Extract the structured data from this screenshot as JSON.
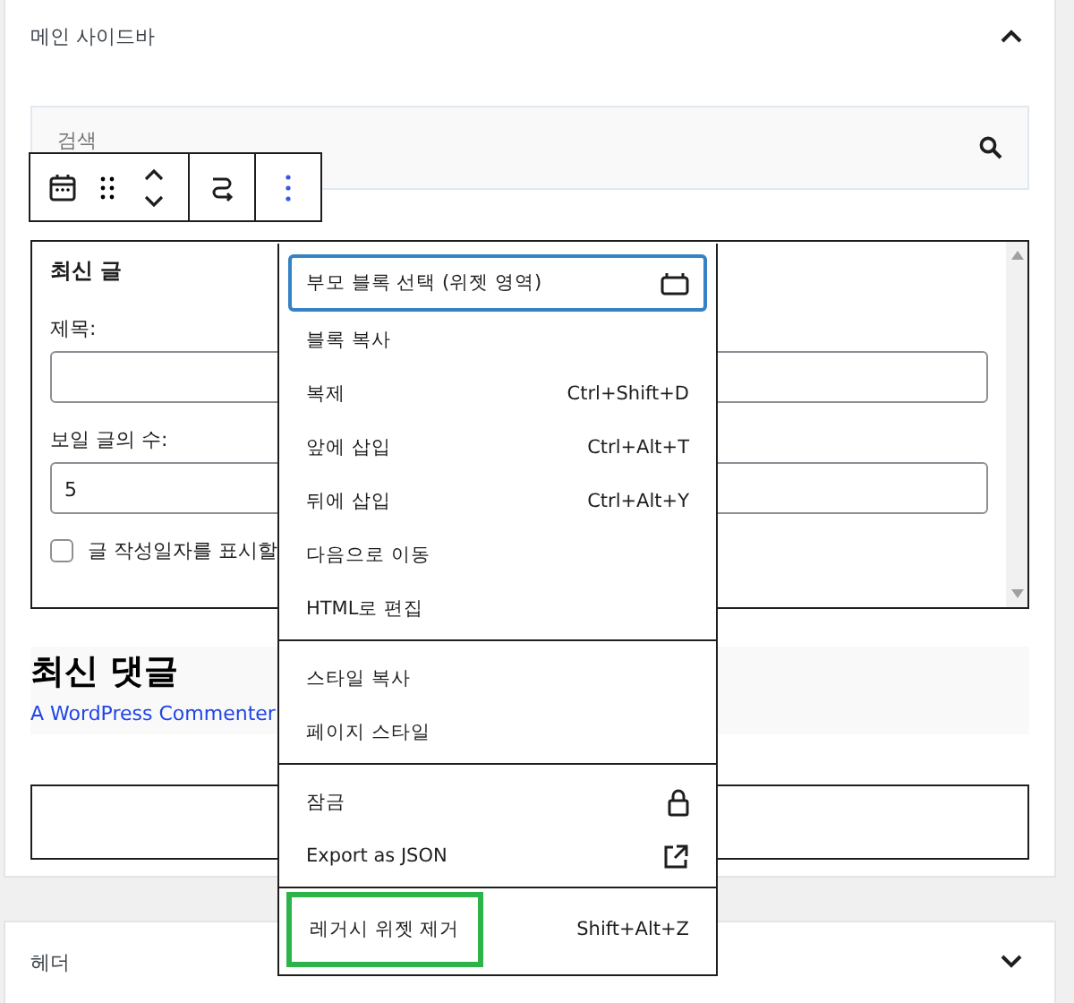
{
  "sidebar_panel": {
    "title": "메인 사이드바",
    "expanded": true
  },
  "search_block": {
    "placeholder": "검색"
  },
  "legacy_widget": {
    "title": "최신 글",
    "fields": [
      {
        "label": "제목:"
      },
      {
        "label": "보일 글의 수:",
        "value": "5"
      }
    ],
    "checkbox": {
      "label": "글 작성일자를 표시할",
      "checked": false
    }
  },
  "comments_block": {
    "heading": "최신 댓글",
    "link": "A WordPress Commenter"
  },
  "menu": {
    "groups": [
      [
        {
          "label": "부모 블록 선택 (위젯 영역)",
          "kind": "block",
          "focused": true,
          "highlighted": false
        },
        {
          "label": "블록 복사",
          "kind": "text",
          "focused": false,
          "highlighted": false
        },
        {
          "label": "복제",
          "shortcut": "Ctrl+Shift+D",
          "kind": "text",
          "focused": false,
          "highlighted": false
        },
        {
          "label": "앞에 삽입",
          "shortcut": "Ctrl+Alt+T",
          "kind": "text",
          "focused": false,
          "highlighted": false
        },
        {
          "label": "뒤에 삽입",
          "shortcut": "Ctrl+Alt+Y",
          "kind": "text",
          "focused": false,
          "highlighted": false
        },
        {
          "label": "다음으로 이동",
          "kind": "text",
          "focused": false,
          "highlighted": false
        },
        {
          "label": "HTML로 편집",
          "kind": "text",
          "focused": false,
          "highlighted": false
        }
      ],
      [
        {
          "label": "스타일 복사",
          "kind": "text",
          "focused": false,
          "highlighted": false
        },
        {
          "label": "페이지 스타일",
          "kind": "text",
          "focused": false,
          "highlighted": false
        }
      ],
      [
        {
          "label": "잠금",
          "kind": "lock",
          "focused": false,
          "highlighted": false
        },
        {
          "label": "Export as JSON",
          "kind": "export",
          "focused": false,
          "highlighted": false
        }
      ],
      [
        {
          "label": "레거시 위젯 제거",
          "shortcut": "Shift+Alt+Z",
          "kind": "text",
          "focused": false,
          "highlighted": true
        }
      ]
    ]
  },
  "header_panel": {
    "title": "헤더",
    "expanded": false
  }
}
